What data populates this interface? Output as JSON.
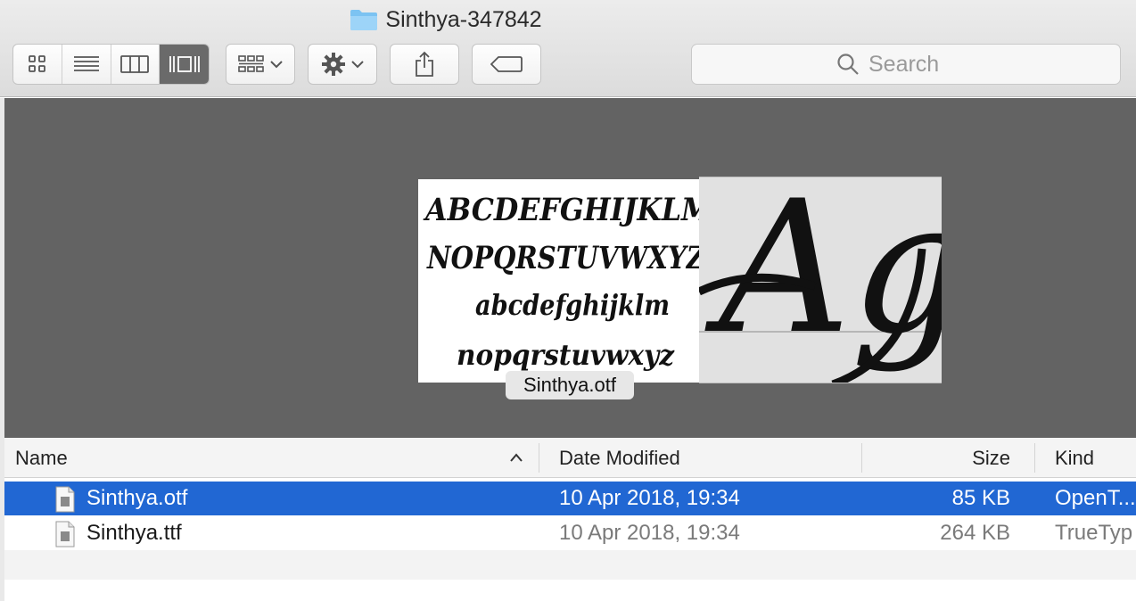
{
  "window": {
    "title": "Sinthya-347842",
    "folder_icon": "folder-icon"
  },
  "toolbar": {
    "view_modes": [
      {
        "name": "icon-view",
        "icon": "grid-icon",
        "active": false
      },
      {
        "name": "list-view",
        "icon": "list-icon",
        "active": false
      },
      {
        "name": "column-view",
        "icon": "columns-icon",
        "active": false
      },
      {
        "name": "cover-flow-view",
        "icon": "cover-flow-icon",
        "active": true
      }
    ],
    "group_icon": "group-by-icon",
    "action_icon": "gear-icon",
    "share_icon": "share-icon",
    "tag_icon": "tag-icon",
    "search_placeholder": "Search",
    "search_icon": "magnifier-icon"
  },
  "preview": {
    "caption": "Sinthya.otf",
    "specimen_lines": [
      "ABCDEFGHIJKLM",
      "NOPQRSTUVWXYZ",
      "abcdefghijklm",
      "nopqrstuvwxyz"
    ],
    "glyph_sample": "Ag",
    "colors": {
      "background": "#636363",
      "caption_bg": "#e7e7e7"
    }
  },
  "list": {
    "columns": {
      "name": "Name",
      "date": "Date Modified",
      "size": "Size",
      "kind": "Kind"
    },
    "sort_indicator": "chevron-up-icon",
    "rows": [
      {
        "name": "Sinthya.otf",
        "date": "10 Apr 2018, 19:34",
        "size": "85 KB",
        "kind": "OpenT...",
        "selected": true
      },
      {
        "name": "Sinthya.ttf",
        "date": "10 Apr 2018, 19:34",
        "size": "264 KB",
        "kind": "TrueTyp",
        "selected": false
      }
    ],
    "selection_color": "#2167d3"
  }
}
